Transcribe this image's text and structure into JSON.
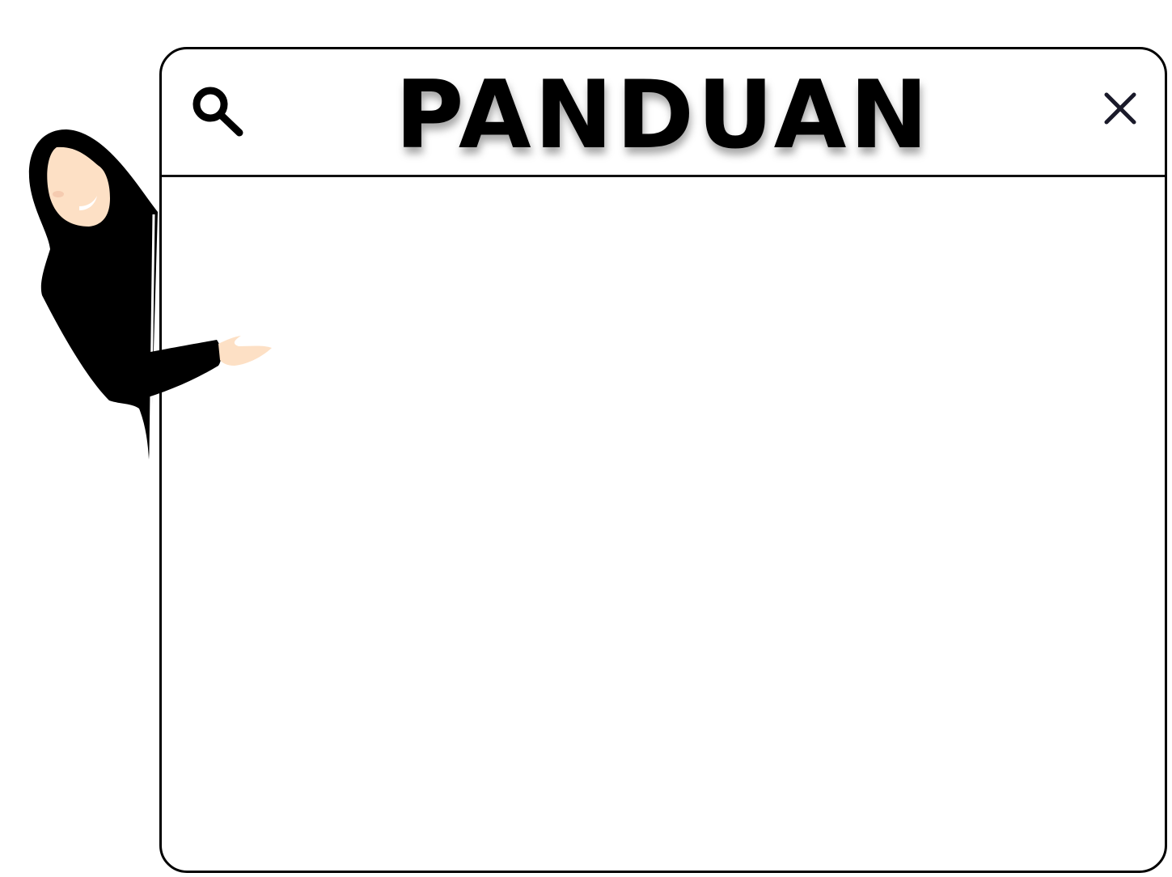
{
  "window": {
    "title": "PANDUAN",
    "search_icon": "search-icon",
    "close_icon": "close-icon"
  },
  "mascot": {
    "icon": "hijab-woman-pointing-illustration"
  },
  "colors": {
    "outline": "#000000",
    "background": "#ffffff",
    "skin": "#fde0c5",
    "hijab": "#000000"
  }
}
